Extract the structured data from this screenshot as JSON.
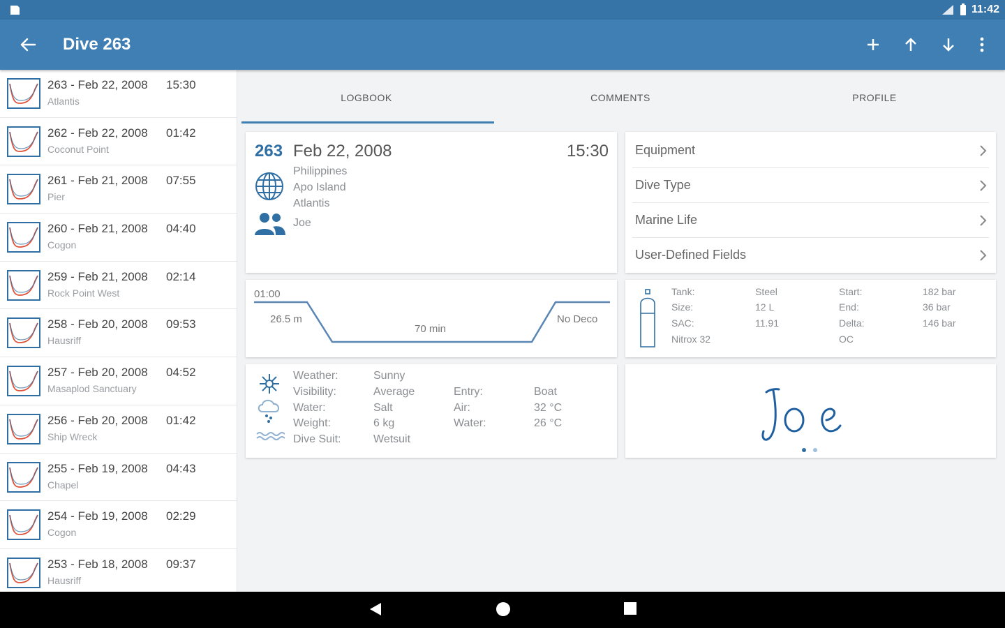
{
  "status_bar": {
    "time": "11:42"
  },
  "app_bar": {
    "title": "Dive 263"
  },
  "dives": [
    {
      "line": "263 - Feb 22, 2008",
      "time": "15:30",
      "site": "Atlantis"
    },
    {
      "line": "262 - Feb 22, 2008",
      "time": "01:42",
      "site": "Coconut Point"
    },
    {
      "line": "261 - Feb 21, 2008",
      "time": "07:55",
      "site": "Pier"
    },
    {
      "line": "260 - Feb 21, 2008",
      "time": "04:40",
      "site": "Cogon"
    },
    {
      "line": "259 - Feb 21, 2008",
      "time": "02:14",
      "site": "Rock Point West"
    },
    {
      "line": "258 - Feb 20, 2008",
      "time": "09:53",
      "site": "Hausriff"
    },
    {
      "line": "257 - Feb 20, 2008",
      "time": "04:52",
      "site": "Masaplod Sanctuary"
    },
    {
      "line": "256 - Feb 20, 2008",
      "time": "01:42",
      "site": "Ship Wreck"
    },
    {
      "line": "255 - Feb 19, 2008",
      "time": "04:43",
      "site": "Chapel"
    },
    {
      "line": "254 - Feb 19, 2008",
      "time": "02:29",
      "site": "Cogon"
    },
    {
      "line": "253 - Feb 18, 2008",
      "time": "09:37",
      "site": "Hausriff"
    }
  ],
  "tabs": [
    "LOGBOOK",
    "COMMENTS",
    "PROFILE"
  ],
  "summary": {
    "number": "263",
    "date": "Feb 22, 2008",
    "time": "15:30",
    "country": "Philippines",
    "island": "Apo Island",
    "site": "Atlantis",
    "buddy": "Joe"
  },
  "nav_items": [
    "Equipment",
    "Dive Type",
    "Marine Life",
    "User-Defined Fields"
  ],
  "profile": {
    "surface_interval": "01:00",
    "max_depth": "26.5 m",
    "duration": "70 min",
    "deco": "No Deco"
  },
  "tank": {
    "tank_label": "Tank:",
    "tank_value": "Steel",
    "size_label": "Size:",
    "size_value": "12 L",
    "sac_label": "SAC:",
    "sac_value": "11.91",
    "gas": "Nitrox 32",
    "start_label": "Start:",
    "start_value": "182 bar",
    "end_label": "End:",
    "end_value": "36 bar",
    "delta_label": "Delta:",
    "delta_value": "146 bar",
    "type": "OC"
  },
  "conditions": {
    "weather_label": "Weather:",
    "weather_value": "Sunny",
    "visibility_label": "Visibility:",
    "visibility_value": "Average",
    "water_label": "Water:",
    "water_value": "Salt",
    "weight_label": "Weight:",
    "weight_value": "6 kg",
    "suit_label": "Dive Suit:",
    "suit_value": "Wetsuit",
    "entry_label": "Entry:",
    "entry_value": "Boat",
    "air_label": "Air:",
    "air_value": "32 °C",
    "watertemp_label": "Water:",
    "watertemp_value": "26 °C"
  },
  "signature": {
    "text": "Joe"
  },
  "colors": {
    "primary": "#3f7fb4",
    "status_bar": "#3673a6",
    "accent_blue": "#2f6fa3",
    "profile_red": "#e0523a"
  }
}
